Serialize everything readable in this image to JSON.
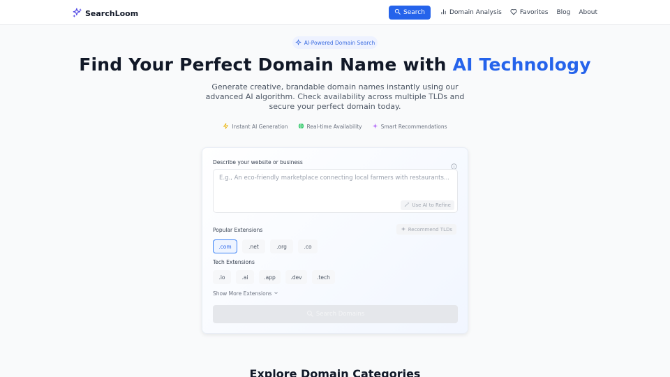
{
  "header": {
    "brand": "SearchLoom",
    "nav": {
      "search_label": "Search",
      "domain_analysis_label": "Domain Analysis",
      "favorites_label": "Favorites",
      "blog_label": "Blog",
      "about_label": "About"
    },
    "colors": {
      "accent": "#2563eb",
      "brand_icon": "#4f46e5"
    }
  },
  "hero": {
    "badge": "AI-Powered Domain Search",
    "headline_main": "Find Your Perfect Domain Name with ",
    "headline_accent": "AI Technology",
    "subtext": "Generate creative, brandable domain names instantly using our advanced AI algorithm. Check availability across multiple TLDs and secure your perfect domain today.",
    "features": [
      {
        "icon": "lightning-icon",
        "label": "Instant AI Generation"
      },
      {
        "icon": "globe-icon",
        "label": "Real-time Availability"
      },
      {
        "icon": "sparkles-icon",
        "label": "Smart Recommendations"
      }
    ]
  },
  "search_card": {
    "description_label": "Describe your website or business",
    "description_placeholder": "E.g., An eco-friendly marketplace connecting local farmers with restaurants...",
    "description_value": "",
    "refine_label": "Use AI to Refine",
    "popular_label": "Popular Extensions",
    "recommend_label": "Recommend TLDs",
    "popular_extensions": [
      {
        "label": ".com",
        "selected": true
      },
      {
        "label": ".net",
        "selected": false
      },
      {
        "label": ".org",
        "selected": false
      },
      {
        "label": ".co",
        "selected": false
      }
    ],
    "tech_label": "Tech Extensions",
    "tech_extensions": [
      {
        "label": ".io",
        "selected": false
      },
      {
        "label": ".ai",
        "selected": false
      },
      {
        "label": ".app",
        "selected": false
      },
      {
        "label": ".dev",
        "selected": false
      },
      {
        "label": ".tech",
        "selected": false
      }
    ],
    "show_more_label": "Show More Extensions",
    "search_button_label": "Search Domains"
  },
  "explore": {
    "title": "Explore Domain Categories"
  }
}
